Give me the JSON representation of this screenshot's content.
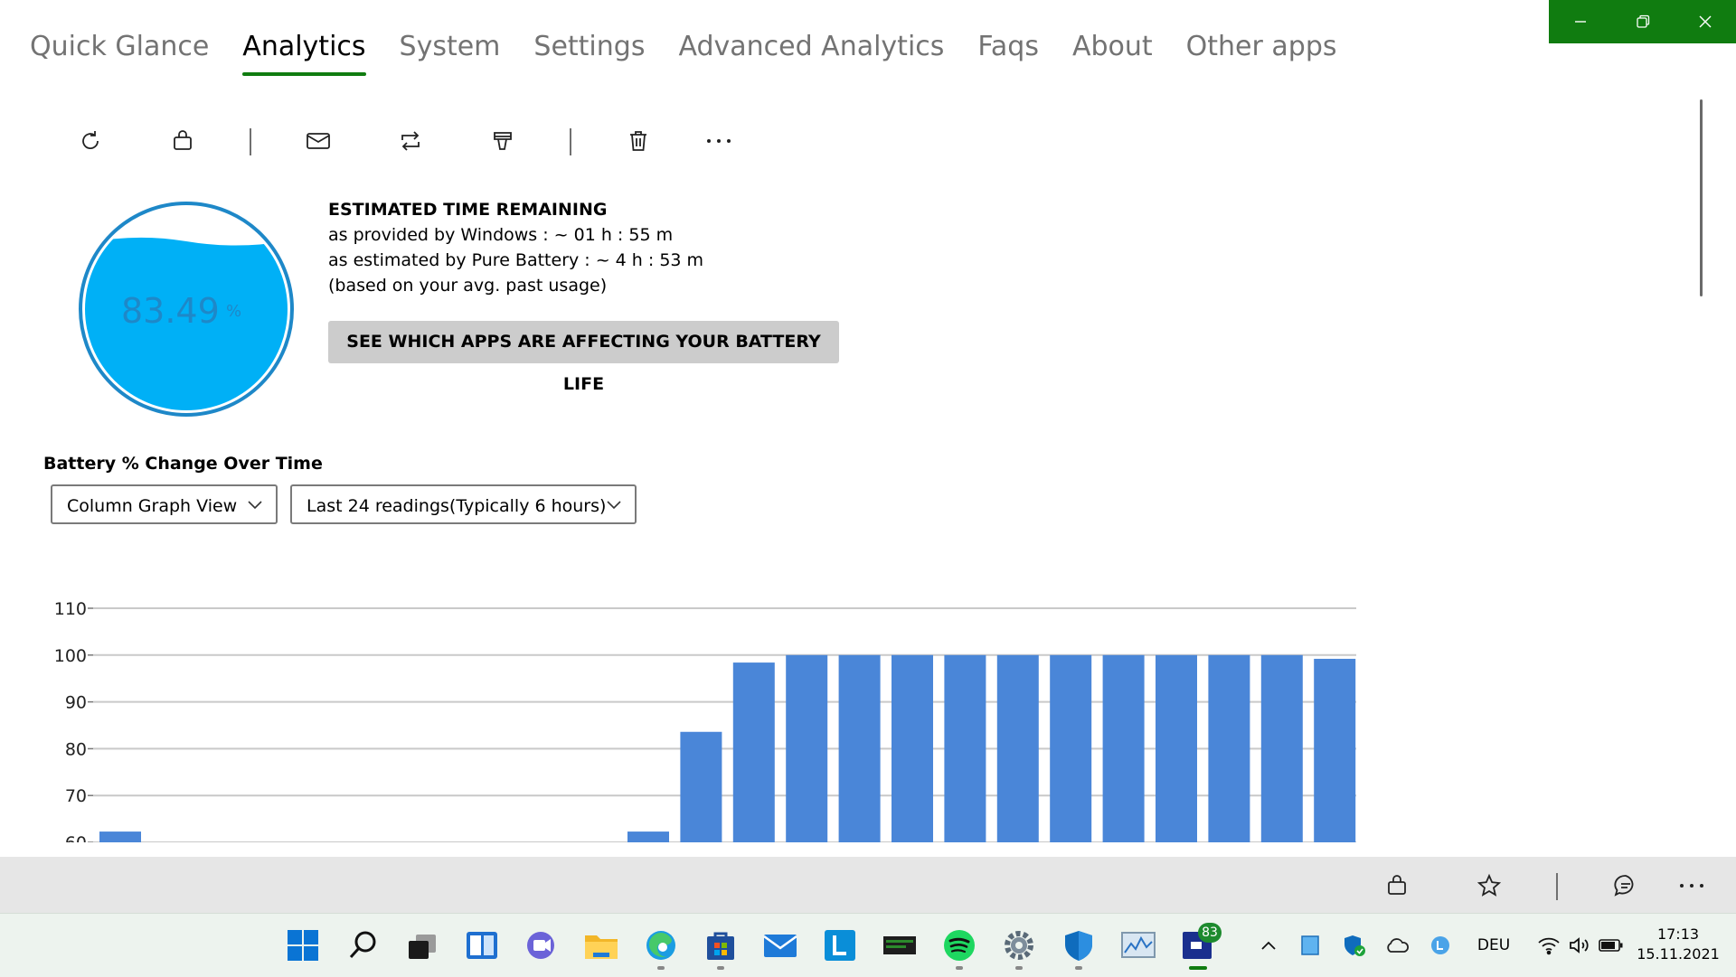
{
  "nav": {
    "tabs": [
      "Quick Glance",
      "Analytics",
      "System",
      "Settings",
      "Advanced Analytics",
      "Faqs",
      "About",
      "Other apps"
    ],
    "active": "Analytics"
  },
  "gauge": {
    "value": "83.49",
    "unit": "%",
    "level_fraction": 0.8349
  },
  "estimate": {
    "title": "ESTIMATED TIME REMAINING",
    "windows": "as provided by Windows : ~ 01 h : 55 m",
    "pure": "as estimated by Pure Battery : ~ 4 h : 53 m",
    "note": "(based on your avg. past usage)"
  },
  "apps_button": "SEE WHICH APPS ARE AFFECTING YOUR BATTERY LIFE",
  "chart_section": {
    "title": "Battery % Change Over Time",
    "view_select": "Column Graph View",
    "range_select": "Last 24 readings(Typically 6 hours)"
  },
  "chart_data": {
    "type": "bar",
    "title": "",
    "xlabel": "",
    "ylabel": "",
    "ylim": [
      60,
      110
    ],
    "yticks": [
      "110",
      "100",
      "90",
      "80",
      "70",
      "60"
    ],
    "grid": true,
    "values": [
      62.3,
      null,
      null,
      null,
      null,
      null,
      null,
      null,
      null,
      null,
      62.3,
      83.6,
      98.4,
      100,
      100,
      100,
      100,
      100,
      100,
      100,
      100,
      100,
      100,
      99.2
    ]
  },
  "colors": {
    "accent": "#107c10",
    "bar": "#4a86d8",
    "gauge_fill": "#00b0f6",
    "gauge_ring": "#1e88c8"
  },
  "taskbar": {
    "badge": "83",
    "lang": "DEU",
    "time": "17:13",
    "date": "15.11.2021"
  }
}
